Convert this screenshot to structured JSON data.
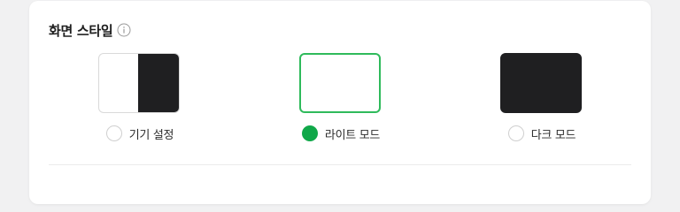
{
  "section": {
    "title": "화면 스타일",
    "info_icon": "info-circle-icon"
  },
  "options": [
    {
      "id": "device",
      "label": "기기 설정",
      "selected": false
    },
    {
      "id": "light",
      "label": "라이트 모드",
      "selected": true
    },
    {
      "id": "dark",
      "label": "다크 모드",
      "selected": false
    }
  ],
  "colors": {
    "accent": "#10a849",
    "selected_border": "#2fba5b",
    "dark_preview": "#1f1f21",
    "page_bg": "#f1f1f2"
  }
}
